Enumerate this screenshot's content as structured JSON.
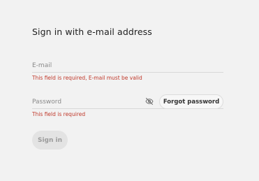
{
  "form": {
    "title": "Sign in with e-mail address",
    "email": {
      "value": "",
      "placeholder": "E-mail",
      "error": "This field is required, E-mail must be valid"
    },
    "password": {
      "value": "",
      "placeholder": "Password",
      "error": "This field is required",
      "visibility_icon": "eye-off-icon"
    },
    "forgot_password_label": "Forgot password",
    "sign_in_label": "Sign in"
  },
  "colors": {
    "background": "#f2f2f2",
    "error": "#c0392b",
    "disabled_button_bg": "#e3e3e3",
    "disabled_button_text": "#9a9a9a"
  }
}
